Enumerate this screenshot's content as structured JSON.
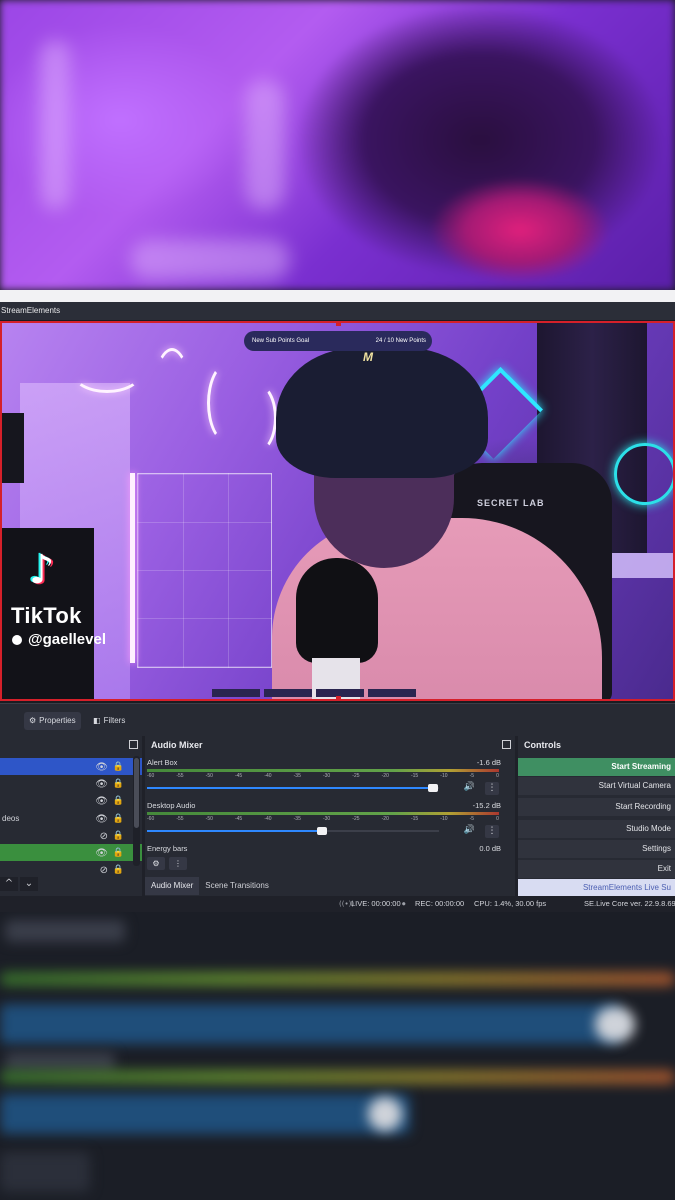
{
  "window": {
    "title": "StreamElements"
  },
  "overlay": {
    "goal_label": "New Sub Points Goal",
    "goal_progress": "24 / 10 New Points",
    "tiktok_brand": "TikTok",
    "tiktok_handle": "@gaellevel",
    "chair_brand": "SECRET LAB",
    "hat_logo": "M"
  },
  "toolbar": {
    "properties_label": "Properties",
    "filters_label": "Filters",
    "properties_icon": "gear-icon",
    "filters_icon": "filter-icon"
  },
  "sources": {
    "items": [
      {
        "label": "",
        "visible": true,
        "locked": true,
        "selected": "blue"
      },
      {
        "label": "",
        "visible": true,
        "locked": true,
        "selected": ""
      },
      {
        "label": "",
        "visible": true,
        "locked": true,
        "selected": ""
      },
      {
        "label": "deos",
        "visible": true,
        "locked": true,
        "selected": ""
      },
      {
        "label": "",
        "visible": false,
        "locked": true,
        "selected": ""
      },
      {
        "label": "",
        "visible": true,
        "locked": true,
        "selected": "green"
      },
      {
        "label": "",
        "visible": false,
        "locked": true,
        "selected": ""
      }
    ]
  },
  "mixer": {
    "title": "Audio Mixer",
    "ticks": [
      "-60",
      "-55",
      "-50",
      "-45",
      "-40",
      "-35",
      "-30",
      "-25",
      "-20",
      "-15",
      "-10",
      "-5",
      "0"
    ],
    "channels": [
      {
        "name": "Alert Box",
        "db": "-1.6 dB",
        "volume_fraction": 0.98
      },
      {
        "name": "Desktop Audio",
        "db": "-15.2 dB",
        "volume_fraction": 0.6
      },
      {
        "name": "Energy bars",
        "db": "0.0 dB"
      }
    ],
    "tabs": [
      "Audio Mixer",
      "Scene Transitions"
    ]
  },
  "controls": {
    "title": "Controls",
    "buttons": [
      "Start Streaming",
      "Start Virtual Camera",
      "Start Recording",
      "Studio Mode",
      "Settings",
      "Exit",
      "StreamElements Live Su"
    ]
  },
  "status": {
    "live": "LIVE: 00:00:00",
    "rec": "REC: 00:00:00",
    "cpu": "CPU: 1.4%, 30.00 fps",
    "version": "SE.Live Core ver. 22.9.8.69 p"
  },
  "colors": {
    "accent_red": "#d5202a",
    "start_green": "#3f8f62",
    "source_blue": "#2e56c8",
    "source_green": "#3a8f3e"
  }
}
